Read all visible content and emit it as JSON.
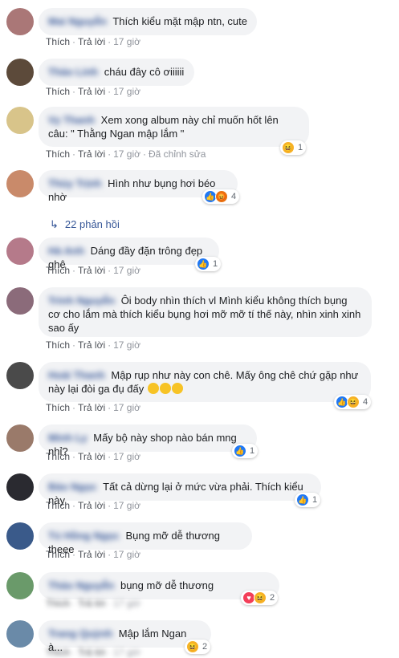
{
  "labels": {
    "like": "Thích",
    "reply": "Trả lời"
  },
  "comments": [
    {
      "name": "Mai Nguyễn",
      "text": "Thích kiểu mặt mập ntn, cute",
      "time": "17 giờ"
    },
    {
      "name": "Thảo Linh",
      "text": "cháu đây cô ơiiiiii",
      "time": "17 giờ"
    },
    {
      "name": "Vy Thanh",
      "text": "Xem xong album này chỉ muốn hốt lên câu: \" Thằng Ngan mập lắm \"",
      "time": "17 giờ",
      "edited": "Đã chỉnh sửa",
      "reaction_count": "1"
    },
    {
      "name": "Thùy Trịnh",
      "text": "Hình như bụng hơi béo nhờ",
      "reaction_count": "4",
      "replies": "22 phản hồi"
    },
    {
      "name": "Hà Anh",
      "text": "Dáng đầy đặn trông đẹp ghê",
      "time": "17 giờ",
      "reaction_count": "1"
    },
    {
      "name": "Trinh Nguyễn",
      "text": "Ôi body nhìn thích vl Mình kiểu không thích bụng cơ cho lắm mà thích kiểu bụng hơi mỡ mỡ tí thế này, nhìn xinh xinh sao ấy",
      "time": "17 giờ"
    },
    {
      "name": "Hoài Thanh",
      "text": "Mập rụp như này con chê. Mấy ông chê chứ gặp như này lại đòi ga đụ đấy",
      "time": "17 giờ",
      "reaction_count": "4"
    },
    {
      "name": "Minh Ly",
      "text": "Mấy bộ này shop nào bán mng nhỉ?",
      "time": "17 giờ",
      "reaction_count": "1"
    },
    {
      "name": "Bảo Ngọc",
      "text": "Tất cả dừng lại ở mức vừa phải. Thích kiểu này",
      "time": "17 giờ",
      "reaction_count": "1"
    },
    {
      "name": "Tú Hồng Ngọc",
      "text": "Bụng mỡ dễ thương theee",
      "time": "17 giờ"
    },
    {
      "name": "Thảo Nguyễn",
      "text": "bụng mỡ dễ thương",
      "time": "17 giờ",
      "reaction_count": "2"
    },
    {
      "name": "Trang Quỳnh",
      "text": "Mập lắm Ngan à...",
      "time": "17 giờ",
      "reaction_count": "2"
    }
  ]
}
